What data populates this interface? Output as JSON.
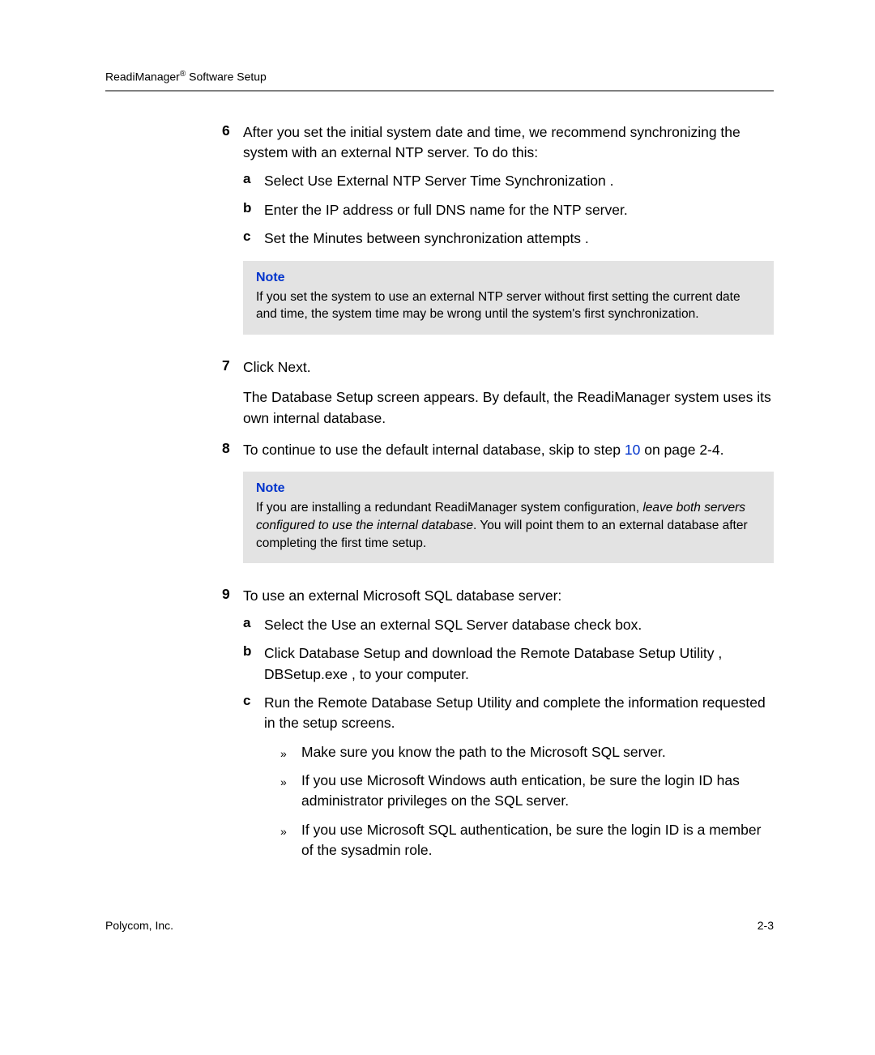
{
  "header": {
    "title_prefix": "ReadiManager",
    "title_suffix": " Software Setup"
  },
  "steps": {
    "s6": {
      "num": "6",
      "text": "After you set the initial system date and time, we recommend synchronizing the system with an external NTP server. To do this:",
      "a": {
        "letter": "a",
        "text": "Select Use External NTP Server Time Synchronization ."
      },
      "b": {
        "letter": "b",
        "text": "Enter the IP address or full DNS name for the NTP server."
      },
      "c": {
        "letter": "c",
        "text": "Set the Minutes between synchronization attempts ."
      }
    },
    "note1": {
      "title": "Note",
      "text": "If you set the system to use an external NTP server without first setting the current date and time, the system time may be wrong until the system's first synchronization."
    },
    "s7": {
      "num": "7",
      "text": "Click Next.",
      "extra": "The Database Setup screen appears. By default, the ReadiManager system uses its own internal database."
    },
    "s8": {
      "num": "8",
      "pre": "To continue to use the default internal database, skip to step ",
      "link": "10",
      "post": " on page 2-4."
    },
    "note2": {
      "title": "Note",
      "pre": "If you are installing a redundant ReadiManager system configuration, ",
      "italic": "leave both servers configured to use the internal database",
      "post": ". You will point them to an external database after completing the first time setup."
    },
    "s9": {
      "num": "9",
      "text": "To use an external Microsoft SQL database server:",
      "a": {
        "letter": "a",
        "text": "Select the Use an external SQL Server database check box."
      },
      "b": {
        "letter": "b",
        "text": "Click Database Setup and download the Remote Database Setup Utility , DBSetup.exe , to your computer."
      },
      "c": {
        "letter": "c",
        "text": "Run the Remote Database Setup Utility  and complete the information requested in the setup screens.",
        "b1": "Make sure you know the path to the Microsoft SQL server.",
        "b2": "If you use Microsoft Windows auth entication, be sure the login ID has administrator privileges on the SQL server.",
        "b3": "If you use Microsoft SQL authentication, be sure the login ID is a member of the sysadmin  role."
      }
    }
  },
  "footer": {
    "left": "Polycom, Inc.",
    "right": "2-3"
  },
  "markers": {
    "raquo": "»"
  }
}
